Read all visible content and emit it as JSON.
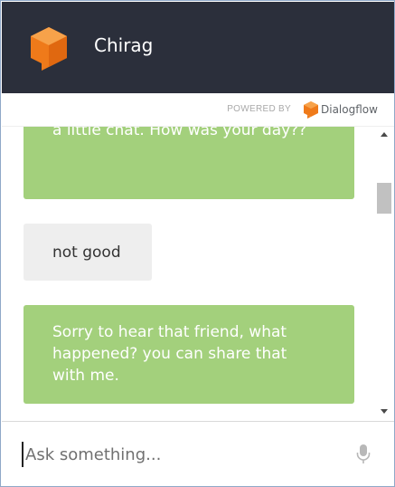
{
  "header": {
    "bot_name": "Chirag",
    "logo_icon": "dialogflow-cube-icon",
    "background": "#2b2f3b"
  },
  "powered": {
    "label": "POWERED BY",
    "brand": "Dialogflow",
    "brand_icon": "dialogflow-icon"
  },
  "messages": [
    {
      "sender": "bot",
      "text": "treat me as a friend and we can have a little chat. How was your day??"
    },
    {
      "sender": "user",
      "text": "not good"
    },
    {
      "sender": "bot",
      "text": "Sorry to hear that friend, what happened? you can share that with me."
    }
  ],
  "input": {
    "placeholder": "Ask something...",
    "mic_icon": "microphone-icon"
  },
  "colors": {
    "bot_bubble": "#a3d07c",
    "user_bubble": "#eeeeee",
    "accent": "#f2851c"
  }
}
